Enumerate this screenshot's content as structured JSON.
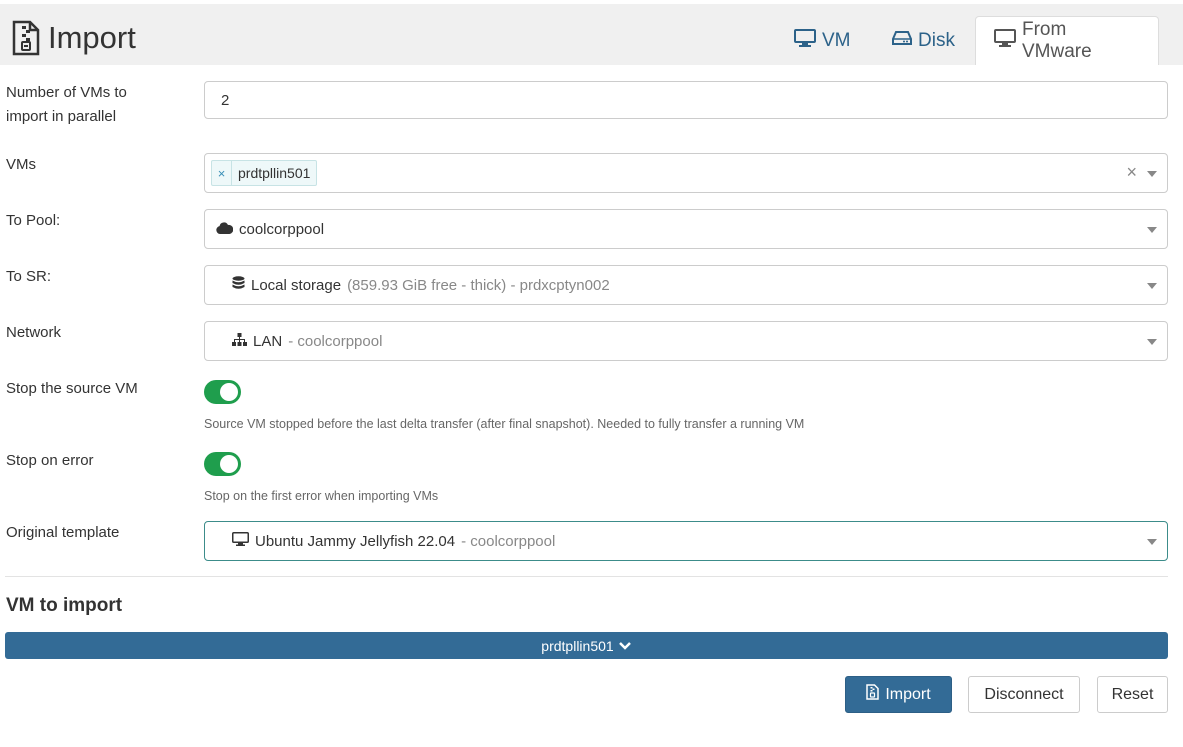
{
  "header": {
    "title": "Import",
    "tabs": [
      {
        "label": "VM"
      },
      {
        "label": "Disk"
      },
      {
        "label": "From VMware"
      }
    ]
  },
  "form": {
    "parallel": {
      "label_line1": "Number of VMs to",
      "label_line2": "import in parallel",
      "value": "2"
    },
    "vms": {
      "label": "VMs",
      "selected": [
        "prdtpllin501"
      ],
      "tag_remove": "×",
      "clear": "×"
    },
    "pool": {
      "label": "To Pool:",
      "value": "coolcorppool"
    },
    "sr": {
      "label": "To SR:",
      "name": "Local storage",
      "detail": "(859.93 GiB free - thick) - prdxcptyn002"
    },
    "network": {
      "label": "Network",
      "name": "LAN",
      "detail": "- coolcorppool"
    },
    "stop_source": {
      "label": "Stop the source VM",
      "enabled": true,
      "help": "Source VM stopped before the last delta transfer (after final snapshot). Needed to fully transfer a running VM"
    },
    "stop_on_error": {
      "label": "Stop on error",
      "enabled": true,
      "help": "Stop on the first error when importing VMs"
    },
    "template": {
      "label": "Original template",
      "name": "Ubuntu Jammy Jellyfish 22.04",
      "detail": "- coolcorppool"
    }
  },
  "vm_section": {
    "title": "VM to import",
    "vm_name": "prdtpllin501"
  },
  "actions": {
    "import_label": "Import",
    "disconnect_label": "Disconnect",
    "reset_label": "Reset"
  },
  "colors": {
    "accent": "#336b96",
    "toggle_on": "#1f9e4d",
    "link": "#2c6289"
  },
  "icons": {
    "title": "file-import-icon",
    "tab_vm": "desktop-icon",
    "tab_disk": "hdd-icon",
    "tab_vmware": "desktop-icon",
    "pool": "cloud-icon",
    "sr": "database-icon",
    "network": "sitemap-icon",
    "template": "desktop-icon",
    "expand": "chevron-down-icon",
    "import": "file-import-icon"
  }
}
